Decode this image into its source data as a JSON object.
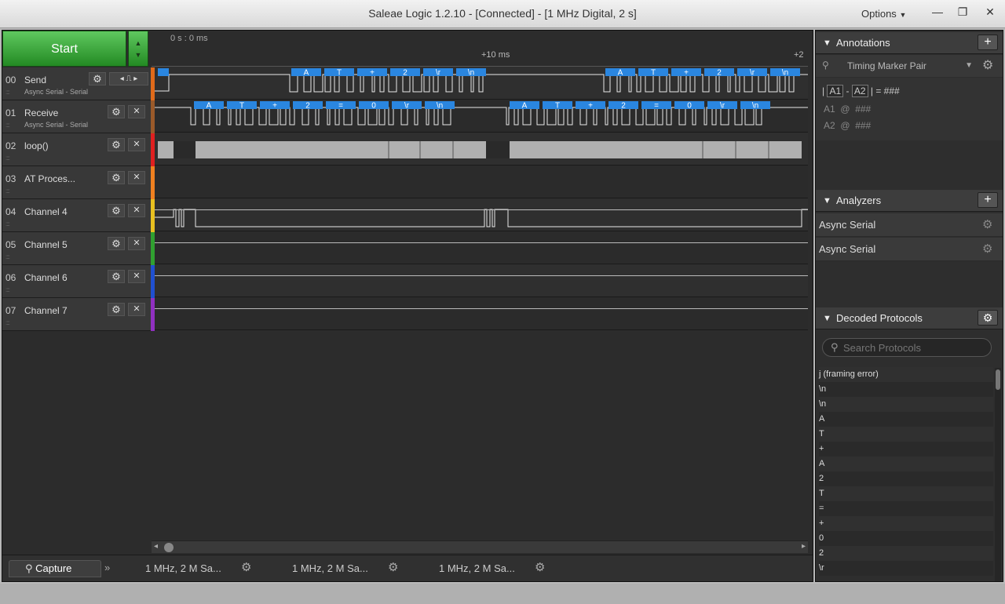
{
  "window": {
    "title": "Saleae Logic 1.2.10 - [Connected] - [1 MHz Digital, 2 s]",
    "options_label": "Options",
    "minimize_glyph": "—",
    "restore_glyph": "❐",
    "close_glyph": "✕"
  },
  "capture": {
    "start_label": "Start",
    "arrows_up": "▲",
    "arrows_down": "▼",
    "time_label": "0 s : 0 ms",
    "ticks": [
      "+10 ms",
      "+2"
    ]
  },
  "channels": [
    {
      "num": "00",
      "name": "Send",
      "sub": "Async Serial - Serial",
      "color": "#e06a1a"
    },
    {
      "num": "01",
      "name": "Receive",
      "sub": "Async Serial - Serial",
      "color": "#9a5a2a"
    },
    {
      "num": "02",
      "name": "loop()",
      "sub": "",
      "color": "#e02020"
    },
    {
      "num": "03",
      "name": "AT Proces...",
      "sub": "",
      "color": "#f08020"
    },
    {
      "num": "04",
      "name": "Channel 4",
      "sub": "",
      "color": "#e8c020"
    },
    {
      "num": "05",
      "name": "Channel 5",
      "sub": "",
      "color": "#30a030"
    },
    {
      "num": "06",
      "name": "Channel 6",
      "sub": "",
      "color": "#2050d0"
    },
    {
      "num": "07",
      "name": "Channel 7",
      "sub": "",
      "color": "#9030c0"
    }
  ],
  "icons": {
    "gear": "⚙",
    "close": "✕",
    "pulse": "⎍",
    "left": "◂",
    "right": "▸",
    "grip": "::::"
  },
  "decodes": {
    "send": [
      "A",
      "T",
      "+",
      "2",
      "\\r",
      "\\n",
      "A",
      "T",
      "+",
      "2",
      "\\r",
      "\\n"
    ],
    "receive": [
      "A",
      "T",
      "+",
      "2",
      "=",
      "0",
      "\\r",
      "\\n",
      "A",
      "T",
      "+",
      "2",
      "=",
      "0",
      "\\r",
      "\\n"
    ]
  },
  "tabs": {
    "capture_label": "Capture",
    "expand_glyph": "»",
    "sessions": [
      "1 MHz, 2 M Sa...",
      "1 MHz, 2 M Sa...",
      "1 MHz, 2 M Sa..."
    ]
  },
  "annotations": {
    "header": "Annotations",
    "add": "+",
    "marker_select": "Timing Marker Pair",
    "a1": "A1",
    "a2": "A2",
    "delta_prefix": "|",
    "delta_sep": "-",
    "delta_value": "| = ###",
    "a1_row": "A1  @  ###",
    "a2_row": "A2  @  ###"
  },
  "analyzers": {
    "header": "Analyzers",
    "add": "+",
    "items": [
      "Async Serial",
      "Async Serial"
    ]
  },
  "decoded": {
    "header": "Decoded Protocols",
    "search_placeholder": "Search Protocols",
    "items": [
      "j (framing error)",
      "\\n",
      "\\n",
      "A",
      "T",
      "+",
      "A",
      "2",
      "T",
      "=",
      "+",
      "0",
      "2",
      "\\r"
    ]
  }
}
